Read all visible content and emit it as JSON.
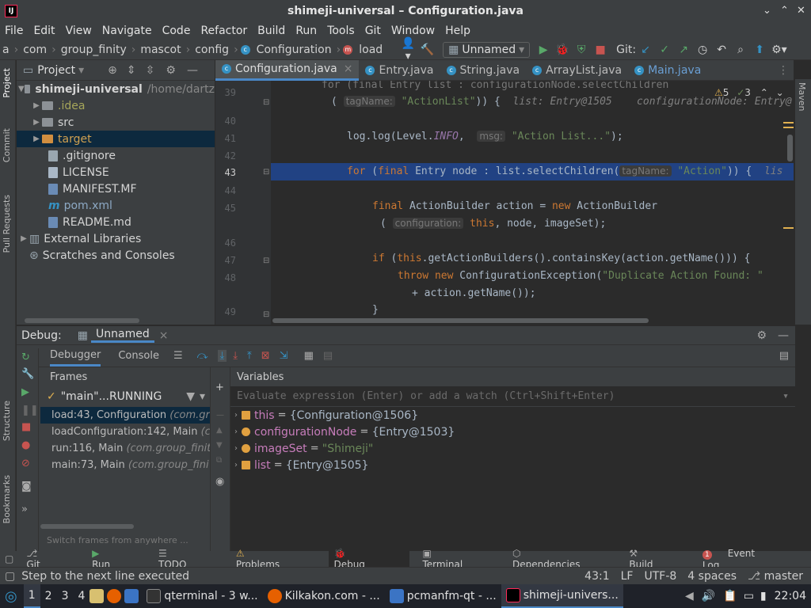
{
  "window": {
    "title": "shimeji-universal – Configuration.java"
  },
  "menu": [
    "File",
    "Edit",
    "View",
    "Navigate",
    "Code",
    "Refactor",
    "Build",
    "Run",
    "Tools",
    "Git",
    "Window",
    "Help"
  ],
  "breadcrumb": [
    "a",
    "com",
    "group_finity",
    "mascot",
    "config",
    "Configuration",
    "load"
  ],
  "run_config": "Unnamed",
  "git_label": "Git:",
  "project": {
    "header": "Project",
    "root_name": "shimeji-universal",
    "root_path": "/home/dartz",
    "items": [
      {
        "label": ".idea",
        "kind": "folder"
      },
      {
        "label": "src",
        "kind": "folder"
      },
      {
        "label": "target",
        "kind": "folder-orange"
      },
      {
        "label": ".gitignore",
        "kind": "file"
      },
      {
        "label": "LICENSE",
        "kind": "file"
      },
      {
        "label": "MANIFEST.MF",
        "kind": "file"
      },
      {
        "label": "pom.xml",
        "kind": "file"
      },
      {
        "label": "README.md",
        "kind": "file"
      },
      {
        "label": "External Libraries",
        "kind": "lib"
      },
      {
        "label": "Scratches and Consoles",
        "kind": "scratch"
      }
    ]
  },
  "tabs": [
    "Configuration.java",
    "Entry.java",
    "String.java",
    "ArrayList.java",
    "Main.java"
  ],
  "inspection": {
    "warnings": "5",
    "weak": "3"
  },
  "code": {
    "l39a": "for (final Entry list : configurationNode.selectChildren",
    "l39b_hint": "tagName:",
    "l39b_str": "\"ActionList\"",
    "l39b_rest": ")) {",
    "l39b_inl1": "list: Entry@1505",
    "l39b_inl2": "configurationNode: Entry@",
    "l41_a": "log.log(Level.",
    "l41_fld": "INFO",
    "l41_b": ", ",
    "l41_hint": "msg:",
    "l41_str": "\"Action List...\"",
    "l41_c": ");",
    "l43_kw1": "for",
    "l43_a": " (",
    "l43_kw2": "final",
    "l43_b": " Entry node : list.selectChildren(",
    "l43_hint": "tagName:",
    "l43_str": "\"Action\"",
    "l43_c": ")) {",
    "l43_inl": "lis",
    "l45_kw": "final",
    "l45_a": " ActionBuilder action = ",
    "l45_kw2": "new",
    "l45_b": " ActionBuilder",
    "l45b_a": "( ",
    "l45b_hint": "configuration:",
    "l45b_kw": "this",
    "l45b_b": ", node, imageSet);",
    "l47_kw": "if",
    "l47_a": " (",
    "l47_kw2": "this",
    "l47_b": ".getActionBuilders().containsKey(action.getName())) {",
    "l48_kw": "throw",
    "l48_kw2": "new",
    "l48_a": " ConfigurationException(",
    "l48_str": "\"Duplicate Action Found: \"",
    "l48b": "+ action.getName());",
    "l49": "}"
  },
  "line_numbers": [
    "39",
    "",
    "40",
    "41",
    "42",
    "43",
    "44",
    "45",
    "",
    "46",
    "47",
    "48",
    "",
    "49"
  ],
  "debug": {
    "label": "Debug:",
    "config": "Unnamed",
    "tab_debugger": "Debugger",
    "tab_console": "Console",
    "frames_header": "Frames",
    "variables_header": "Variables",
    "thread": "\"main\"...RUNNING",
    "frames": [
      {
        "method": "load:43, Configuration",
        "pkg": "(com.gr"
      },
      {
        "method": "loadConfiguration:142, Main",
        "pkg": "(c"
      },
      {
        "method": "run:116, Main",
        "pkg": "(com.group_finit"
      },
      {
        "method": "main:73, Main",
        "pkg": "(com.group_fini"
      }
    ],
    "frames_hint": "Switch frames from anywhere ...",
    "eval_placeholder": "Evaluate expression (Enter) or add a watch (Ctrl+Shift+Enter)",
    "variables": [
      {
        "name": "this",
        "value": "{Configuration@1506}",
        "icon": "field",
        "is_string": false
      },
      {
        "name": "configurationNode",
        "value": "{Entry@1503}",
        "icon": "param",
        "is_string": false
      },
      {
        "name": "imageSet",
        "value": "\"Shimeji\"",
        "icon": "param",
        "is_string": true
      },
      {
        "name": "list",
        "value": "{Entry@1505}",
        "icon": "field",
        "is_string": false
      }
    ]
  },
  "left_strip": [
    "Project",
    "Commit",
    "Pull Requests",
    "Structure",
    "Bookmarks"
  ],
  "right_strip": [
    "Maven"
  ],
  "bottom_tabs": [
    "Git",
    "Run",
    "TODO",
    "Problems",
    "Debug",
    "Terminal",
    "Dependencies",
    "Build"
  ],
  "event_log": {
    "count": "1",
    "label": "Event Log"
  },
  "status": {
    "message": "Step to the next line executed",
    "position": "43:1",
    "line_sep": "LF",
    "encoding": "UTF-8",
    "indent": "4 spaces",
    "branch": "master"
  },
  "taskbar": {
    "workspaces": [
      "1",
      "2",
      "3",
      "4"
    ],
    "tasks": [
      "qterminal - 3 w...",
      "Kilkakon.com - ...",
      "pcmanfm-qt - ...",
      "shimeji-univers..."
    ],
    "clock": "22:04"
  }
}
